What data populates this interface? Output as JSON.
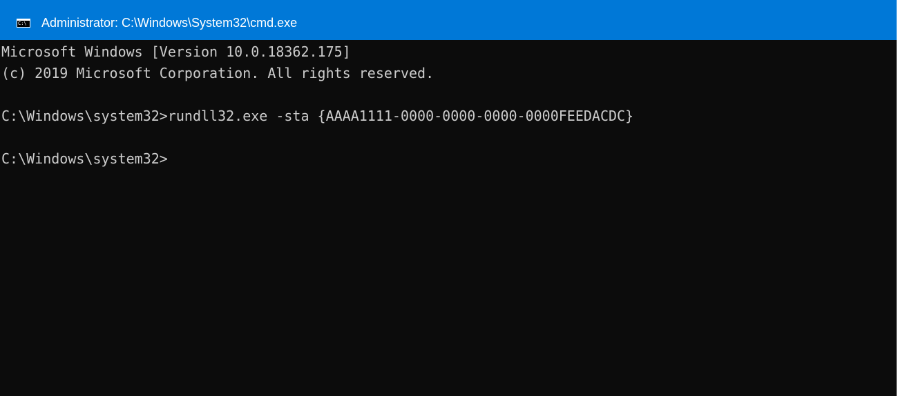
{
  "window": {
    "title": "Administrator: C:\\Windows\\System32\\cmd.exe",
    "icon": "cmd-icon",
    "icon_text": "C:\\"
  },
  "console": {
    "lines": [
      "Microsoft Windows [Version 10.0.18362.175]",
      "(c) 2019 Microsoft Corporation. All rights reserved.",
      "",
      "C:\\Windows\\system32>rundll32.exe -sta {AAAA1111-0000-0000-0000-0000FEEDACDC}",
      "",
      "C:\\Windows\\system32>"
    ]
  },
  "colors": {
    "titlebar": "#0078d7",
    "console_bg": "#0c0c0c",
    "console_fg": "#cccccc"
  }
}
